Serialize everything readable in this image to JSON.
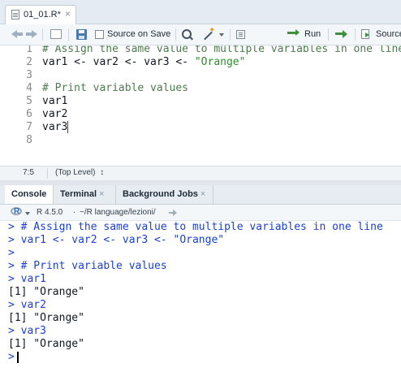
{
  "editor": {
    "tab": {
      "filename": "01_01.R*",
      "close": "×"
    },
    "toolbar": {
      "source_on_save": "Source on Save",
      "run": "Run",
      "source": "Source"
    },
    "lines": [
      {
        "number": "1",
        "text": "# Assign the same value to multiple variables in one line",
        "kind": "comment"
      },
      {
        "number": "2",
        "text": "var1 <- var2 <- var3 <- ",
        "string": "\"Orange\"",
        "kind": "code"
      },
      {
        "number": "3",
        "text": "",
        "kind": "blank"
      },
      {
        "number": "4",
        "text": "# Print variable values",
        "kind": "comment"
      },
      {
        "number": "5",
        "text": "var1",
        "kind": "code"
      },
      {
        "number": "6",
        "text": "var2",
        "kind": "code"
      },
      {
        "number": "7",
        "text": "var3",
        "kind": "code"
      },
      {
        "number": "8",
        "text": "",
        "kind": "blank"
      }
    ],
    "status": {
      "cursor_pos": "7:5",
      "scope": "(Top Level)",
      "scope_arrows": "↕"
    }
  },
  "console": {
    "tabs": [
      {
        "label": "Console",
        "closable": false
      },
      {
        "label": "Terminal",
        "closable": true
      },
      {
        "label": "Background Jobs",
        "closable": true
      }
    ],
    "version": "R 4.5.0",
    "path": "~/R language/lezioni/",
    "path_sep": "·",
    "output": [
      {
        "text": "> # Assign the same value to multiple variables in one line",
        "kind": "input"
      },
      {
        "text": "> var1 <- var2 <- var3 <- \"Orange\"",
        "kind": "input"
      },
      {
        "text": ">",
        "kind": "input"
      },
      {
        "text": "> # Print variable values",
        "kind": "input"
      },
      {
        "text": "> var1",
        "kind": "input"
      },
      {
        "text": "[1] \"Orange\"",
        "kind": "output"
      },
      {
        "text": "> var2",
        "kind": "input"
      },
      {
        "text": "[1] \"Orange\"",
        "kind": "output"
      },
      {
        "text": "> var3",
        "kind": "input"
      },
      {
        "text": "[1] \"Orange\"",
        "kind": "output"
      }
    ],
    "prompt": ">"
  },
  "icons": {
    "back": "arrow-left-icon",
    "forward": "arrow-right-icon",
    "show_in_window": "show-in-window-icon",
    "save": "save-icon",
    "find": "search-icon",
    "code_tools": "wand-icon",
    "compile_report": "report-icon",
    "run": "run-icon",
    "rerun": "rerun-icon",
    "source": "source-icon",
    "r_logo": "r-logo-icon",
    "go_to_dir": "share-icon"
  },
  "colors": {
    "comment": "#4f7a4f",
    "string": "#2b8f2b",
    "console_input": "#1a3fd6",
    "console_output": "#101820"
  }
}
